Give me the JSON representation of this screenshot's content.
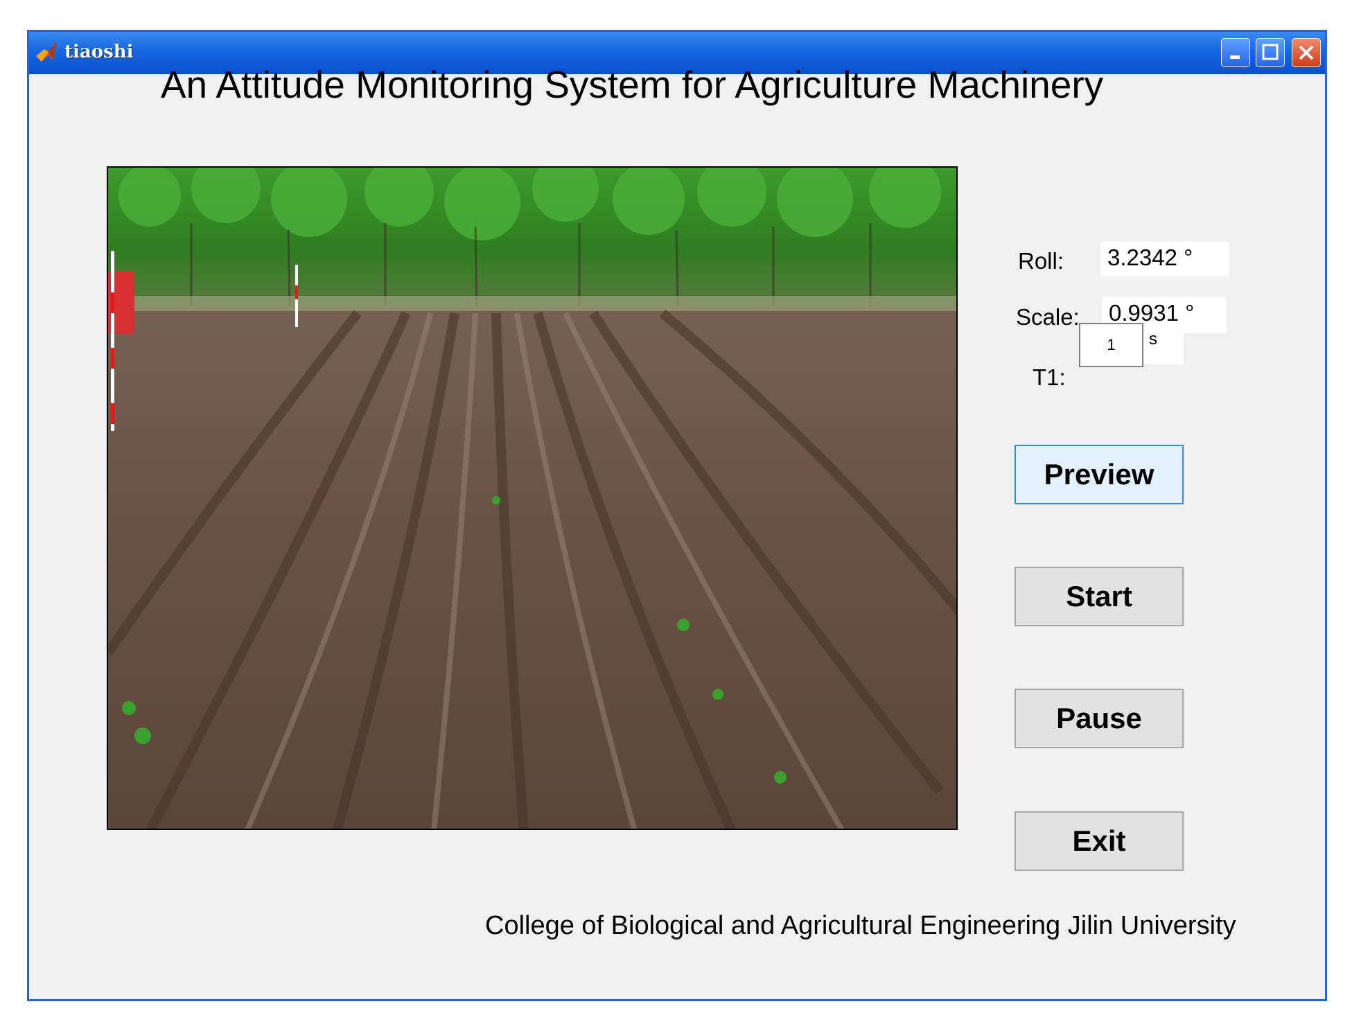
{
  "window": {
    "title": "tiaoshi"
  },
  "app_title": "An Attitude Monitoring System for Agriculture Machinery",
  "readouts": {
    "roll": {
      "label": "Roll:",
      "value": "3.2342 °"
    },
    "scale": {
      "label": "Scale:",
      "value": "0.9931 °"
    },
    "t1": {
      "label": "T1:",
      "value": "1",
      "unit": "s"
    }
  },
  "buttons": {
    "preview": "Preview",
    "start": "Start",
    "pause": "Pause",
    "exit": "Exit"
  },
  "footer": "College of Biological and Agricultural Engineering Jilin University",
  "icons": [
    "matlab-logo-icon",
    "minimize-icon",
    "maximize-icon",
    "close-icon"
  ],
  "colors": {
    "titlebar": "#1667e0",
    "close": "#d23c18",
    "preview_border": "#2f8ee0"
  }
}
